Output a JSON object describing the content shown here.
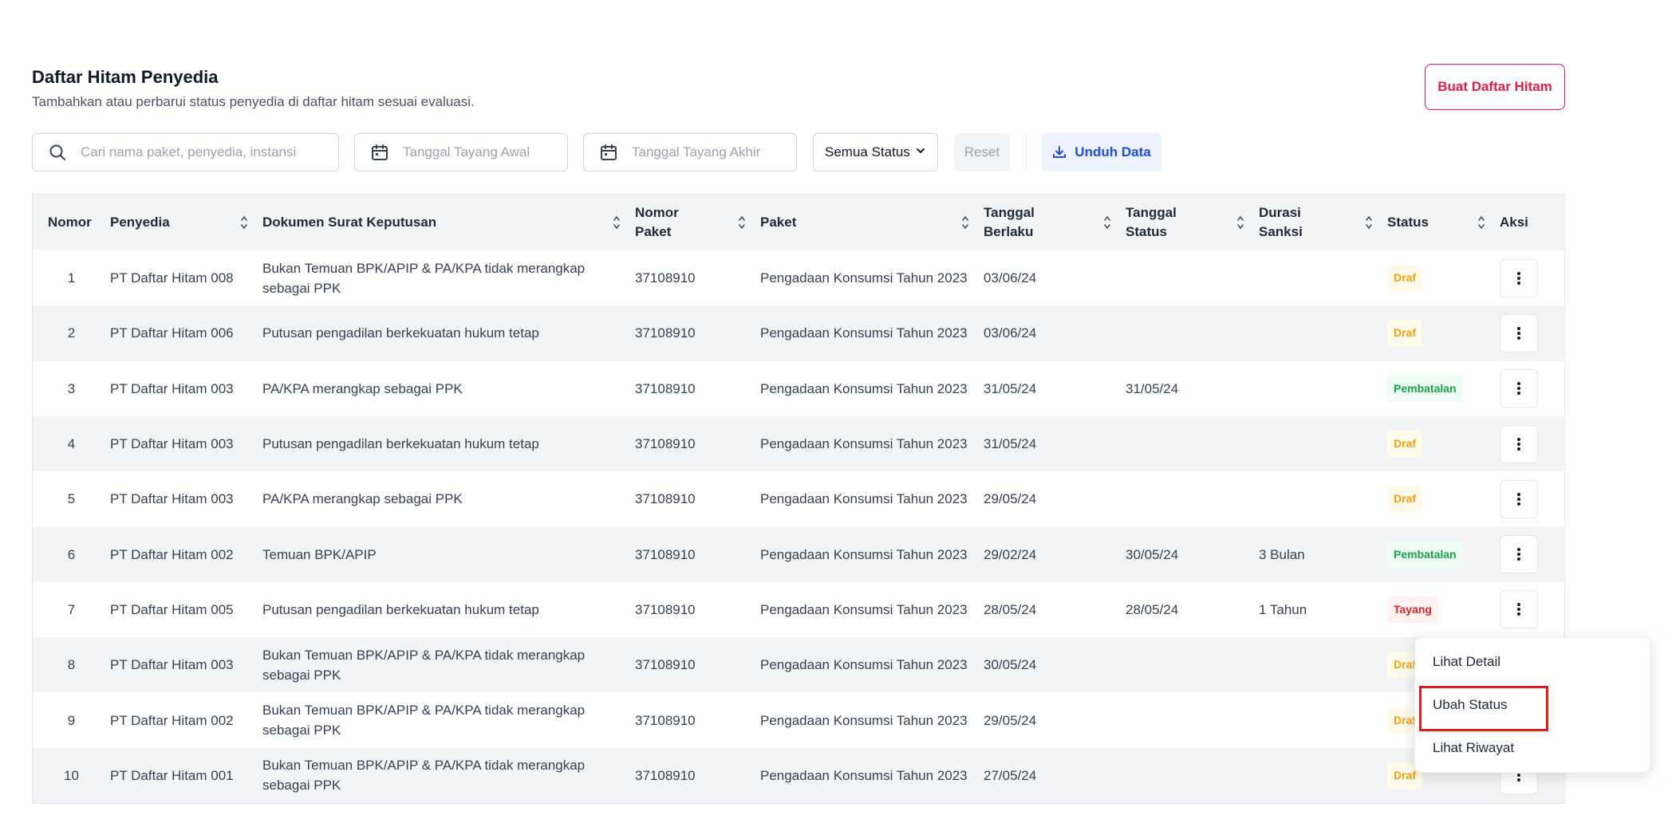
{
  "page": {
    "title": "Daftar Hitam Penyedia",
    "subtitle": "Tambahkan atau perbarui status penyedia di daftar hitam sesuai evaluasi.",
    "create_button": "Buat Daftar Hitam"
  },
  "filters": {
    "search_placeholder": "Cari nama paket, penyedia, instansi",
    "date_start_placeholder": "Tanggal Tayang Awal",
    "date_end_placeholder": "Tanggal Tayang Akhir",
    "status_select": "Semua Status",
    "reset_label": "Reset",
    "download_label": "Unduh Data"
  },
  "table": {
    "headers": {
      "no": "Nomor",
      "penyedia": "Penyedia",
      "dokumen": "Dokumen Surat Keputusan",
      "nomor_paket": "Nomor Paket",
      "paket": "Paket",
      "tanggal_berlaku": "Tanggal Berlaku",
      "tanggal_status": "Tanggal Status",
      "durasi": "Durasi Sanksi",
      "status": "Status",
      "aksi": "Aksi"
    },
    "rows": [
      {
        "no": "1",
        "penyedia": "PT Daftar Hitam 008",
        "dokumen": "Bukan Temuan BPK/APIP & PA/KPA tidak merangkap sebagai PPK",
        "nomor_paket": "37108910",
        "paket": "Pengadaan Konsumsi Tahun 2023",
        "tanggal_berlaku": "03/06/24",
        "tanggal_status": "",
        "durasi": "",
        "status": "Draf"
      },
      {
        "no": "2",
        "penyedia": "PT Daftar Hitam 006",
        "dokumen": "Putusan pengadilan berkekuatan hukum tetap",
        "nomor_paket": "37108910",
        "paket": "Pengadaan Konsumsi Tahun 2023",
        "tanggal_berlaku": "03/06/24",
        "tanggal_status": "",
        "durasi": "",
        "status": "Draf"
      },
      {
        "no": "3",
        "penyedia": "PT Daftar Hitam 003",
        "dokumen": "PA/KPA merangkap sebagai PPK",
        "nomor_paket": "37108910",
        "paket": "Pengadaan Konsumsi Tahun 2023",
        "tanggal_berlaku": "31/05/24",
        "tanggal_status": "31/05/24",
        "durasi": "",
        "status": "Pembatalan"
      },
      {
        "no": "4",
        "penyedia": "PT Daftar Hitam 003",
        "dokumen": "Putusan pengadilan berkekuatan hukum tetap",
        "nomor_paket": "37108910",
        "paket": "Pengadaan Konsumsi Tahun 2023",
        "tanggal_berlaku": "31/05/24",
        "tanggal_status": "",
        "durasi": "",
        "status": "Draf"
      },
      {
        "no": "5",
        "penyedia": "PT Daftar Hitam 003",
        "dokumen": "PA/KPA merangkap sebagai PPK",
        "nomor_paket": "37108910",
        "paket": "Pengadaan Konsumsi Tahun 2023",
        "tanggal_berlaku": "29/05/24",
        "tanggal_status": "",
        "durasi": "",
        "status": "Draf"
      },
      {
        "no": "6",
        "penyedia": "PT Daftar Hitam 002",
        "dokumen": "Temuan BPK/APIP",
        "nomor_paket": "37108910",
        "paket": "Pengadaan Konsumsi Tahun 2023",
        "tanggal_berlaku": "29/02/24",
        "tanggal_status": "30/05/24",
        "durasi": "3 Bulan",
        "status": "Pembatalan"
      },
      {
        "no": "7",
        "penyedia": "PT Daftar Hitam 005",
        "dokumen": "Putusan pengadilan berkekuatan hukum tetap",
        "nomor_paket": "37108910",
        "paket": "Pengadaan Konsumsi Tahun 2023",
        "tanggal_berlaku": "28/05/24",
        "tanggal_status": "28/05/24",
        "durasi": "1 Tahun",
        "status": "Tayang"
      },
      {
        "no": "8",
        "penyedia": "PT Daftar Hitam 003",
        "dokumen": "Bukan Temuan BPK/APIP & PA/KPA tidak merangkap sebagai PPK",
        "nomor_paket": "37108910",
        "paket": "Pengadaan Konsumsi Tahun 2023",
        "tanggal_berlaku": "30/05/24",
        "tanggal_status": "",
        "durasi": "",
        "status": "Draf"
      },
      {
        "no": "9",
        "penyedia": "PT Daftar Hitam 002",
        "dokumen": "Bukan Temuan BPK/APIP & PA/KPA tidak merangkap sebagai PPK",
        "nomor_paket": "37108910",
        "paket": "Pengadaan Konsumsi Tahun 2023",
        "tanggal_berlaku": "29/05/24",
        "tanggal_status": "",
        "durasi": "",
        "status": "Draf"
      },
      {
        "no": "10",
        "penyedia": "PT Daftar Hitam 001",
        "dokumen": "Bukan Temuan BPK/APIP & PA/KPA tidak merangkap sebagai PPK",
        "nomor_paket": "37108910",
        "paket": "Pengadaan Konsumsi Tahun 2023",
        "tanggal_berlaku": "27/05/24",
        "tanggal_status": "",
        "durasi": "",
        "status": "Draf"
      }
    ]
  },
  "action_menu": {
    "items": [
      "Lihat Detail",
      "Ubah Status",
      "Lihat Riwayat"
    ],
    "highlighted": "Ubah Status"
  },
  "colors": {
    "accent_red": "#e11d48",
    "download_blue": "#1d4ed8",
    "status_draf": "#f59e0b",
    "status_pembatalan": "#16a34a",
    "status_tayang": "#dc2626",
    "highlight_box": "#e11d1d"
  }
}
